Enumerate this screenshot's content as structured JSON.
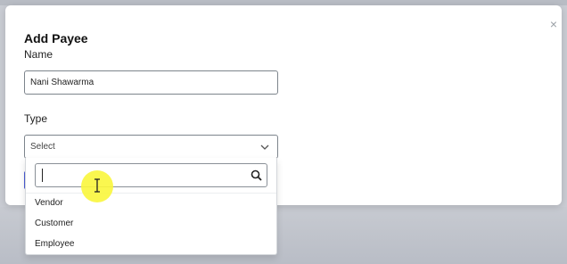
{
  "modal": {
    "title": "Add Payee",
    "close_glyph": "×",
    "name_label": "Name",
    "name_value": "Nani Shawarma",
    "type_label": "Type",
    "type_selected": "Select"
  },
  "dropdown": {
    "search_value": "",
    "options": [
      "Vendor",
      "Customer",
      "Employee"
    ]
  },
  "icons": {
    "close": "close-icon",
    "chevron": "chevron-down-icon",
    "search": "search-icon",
    "cursor": "text-cursor-icon"
  },
  "colors": {
    "cursor_highlight": "#faf63c",
    "accent": "#4a5cd6"
  }
}
